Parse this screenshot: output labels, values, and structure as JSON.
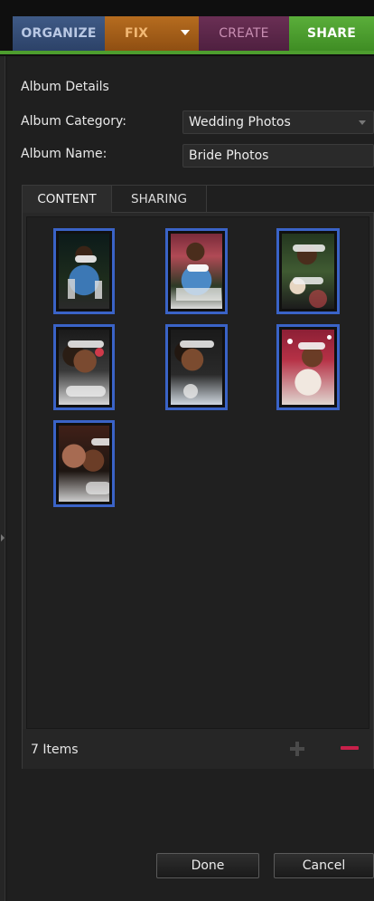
{
  "mode_tabs": {
    "organize": "ORGANIZE",
    "fix": "FIX",
    "create": "CREATE",
    "share": "SHARE"
  },
  "album": {
    "section_title": "Album Details",
    "category_label": "Album Category:",
    "category_value": "Wedding Photos",
    "name_label": "Album Name:",
    "name_value": "Bride Photos"
  },
  "content_tabs": {
    "content": "CONTENT",
    "sharing": "SHARING"
  },
  "photos": [
    {
      "alt": "Bride photo 1"
    },
    {
      "alt": "Bride photo 2"
    },
    {
      "alt": "Bride photo 3"
    },
    {
      "alt": "Bride photo 4"
    },
    {
      "alt": "Bride photo 5"
    },
    {
      "alt": "Bride photo 6"
    },
    {
      "alt": "Bride photo 7"
    }
  ],
  "footer": {
    "item_count": "7 Items"
  },
  "buttons": {
    "done": "Done",
    "cancel": "Cancel"
  },
  "colors": {
    "selection_border": "#3a63c7",
    "share_accent": "#4d9d2e",
    "remove_accent": "#c8204a"
  }
}
